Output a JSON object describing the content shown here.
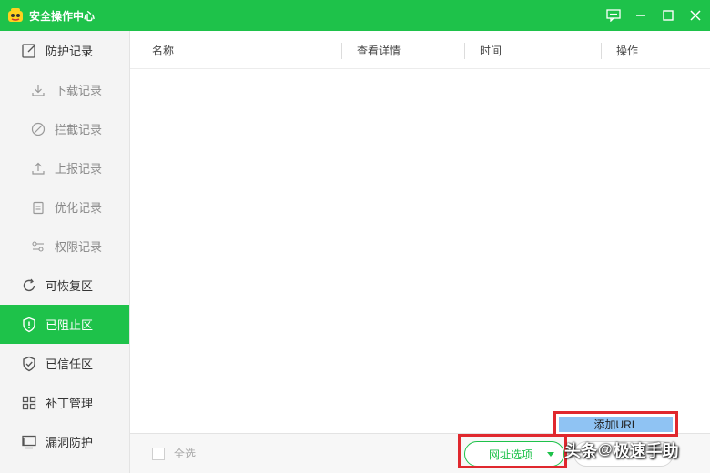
{
  "window": {
    "title": "安全操作中心"
  },
  "sidebar": {
    "items": [
      {
        "label": "防护记录",
        "icon": "edit-icon",
        "type": "main"
      },
      {
        "label": "下载记录",
        "icon": "download-icon",
        "type": "sub"
      },
      {
        "label": "拦截记录",
        "icon": "block-icon",
        "type": "sub"
      },
      {
        "label": "上报记录",
        "icon": "upload-icon",
        "type": "sub"
      },
      {
        "label": "优化记录",
        "icon": "clipboard-icon",
        "type": "sub"
      },
      {
        "label": "权限记录",
        "icon": "sliders-icon",
        "type": "sub"
      },
      {
        "label": "可恢复区",
        "icon": "refresh-icon",
        "type": "main"
      },
      {
        "label": "已阻止区",
        "icon": "shield-alert-icon",
        "type": "main",
        "active": true
      },
      {
        "label": "已信任区",
        "icon": "shield-check-icon",
        "type": "main"
      },
      {
        "label": "补丁管理",
        "icon": "grid-icon",
        "type": "main"
      },
      {
        "label": "漏洞防护",
        "icon": "monitor-icon",
        "type": "main"
      }
    ]
  },
  "table": {
    "columns": [
      "名称",
      "查看详情",
      "时间",
      "操作"
    ],
    "rows": []
  },
  "footer": {
    "select_all": "全选",
    "url_options": "网址选项"
  },
  "dropdown": {
    "items": [
      "添加URL"
    ]
  },
  "watermark": {
    "prefix": "头条",
    "at": "@",
    "name": "极速手助"
  },
  "colors": {
    "accent": "#1ec24a",
    "highlight_border": "#e0282e",
    "dropdown_selected": "#8fc3f3"
  }
}
